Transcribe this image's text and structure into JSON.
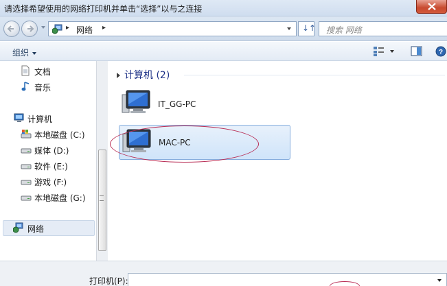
{
  "window": {
    "title": "请选择希望使用的网络打印机并单击“选择”以与之连接"
  },
  "address": {
    "crumb": "网络",
    "search_placeholder": "搜索 网络"
  },
  "toolbar": {
    "organize_label": "组织"
  },
  "nav": {
    "items": [
      {
        "label": "文档",
        "icon": "document-icon"
      },
      {
        "label": "音乐",
        "icon": "music-icon"
      },
      {
        "label": "计算机",
        "icon": "computer-icon"
      },
      {
        "label": "本地磁盘 (C:)",
        "icon": "system-drive-icon"
      },
      {
        "label": "媒体 (D:)",
        "icon": "drive-icon"
      },
      {
        "label": "软件 (E:)",
        "icon": "drive-icon"
      },
      {
        "label": "游戏 (F:)",
        "icon": "drive-icon"
      },
      {
        "label": "本地磁盘 (G:)",
        "icon": "drive-icon"
      },
      {
        "label": "网络",
        "icon": "network-icon"
      }
    ]
  },
  "content": {
    "group_header": "计算机 (2)",
    "computers": [
      {
        "name": "IT_GG-PC"
      },
      {
        "name": "MAC-PC"
      }
    ]
  },
  "bottom": {
    "printer_label": "打印机(P):",
    "printer_value": ""
  }
}
